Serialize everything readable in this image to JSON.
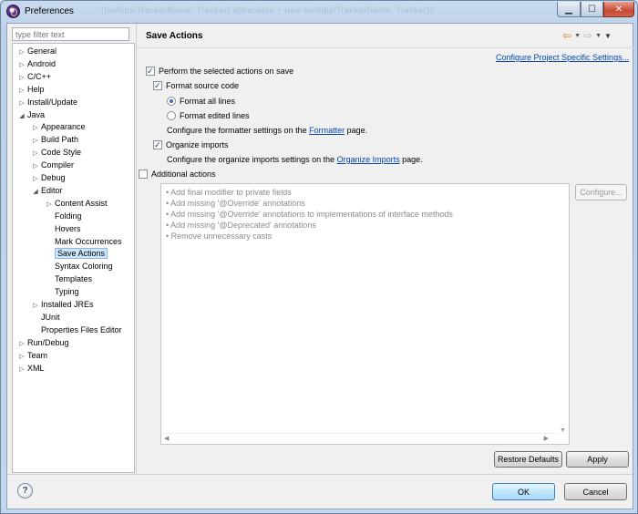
{
  "window": {
    "title": "Preferences",
    "blurred_title_text": "(tooltips/TrackerName, Tracker) a(trackers + new tooltips/TrackerName, Tracker));"
  },
  "filter": {
    "placeholder": "type filter text"
  },
  "tree": [
    {
      "label": "General",
      "arrow": "▷",
      "indent": 0
    },
    {
      "label": "Android",
      "arrow": "▷",
      "indent": 0
    },
    {
      "label": "C/C++",
      "arrow": "▷",
      "indent": 0
    },
    {
      "label": "Help",
      "arrow": "▷",
      "indent": 0
    },
    {
      "label": "Install/Update",
      "arrow": "▷",
      "indent": 0
    },
    {
      "label": "Java",
      "arrow": "◢",
      "indent": 0
    },
    {
      "label": "Appearance",
      "arrow": "▷",
      "indent": 1
    },
    {
      "label": "Build Path",
      "arrow": "▷",
      "indent": 1
    },
    {
      "label": "Code Style",
      "arrow": "▷",
      "indent": 1
    },
    {
      "label": "Compiler",
      "arrow": "▷",
      "indent": 1
    },
    {
      "label": "Debug",
      "arrow": "▷",
      "indent": 1
    },
    {
      "label": "Editor",
      "arrow": "◢",
      "indent": 1
    },
    {
      "label": "Content Assist",
      "arrow": "▷",
      "indent": 2
    },
    {
      "label": "Folding",
      "arrow": "",
      "indent": 2
    },
    {
      "label": "Hovers",
      "arrow": "",
      "indent": 2
    },
    {
      "label": "Mark Occurrences",
      "arrow": "",
      "indent": 2
    },
    {
      "label": "Save Actions",
      "arrow": "",
      "indent": 2,
      "selected": true
    },
    {
      "label": "Syntax Coloring",
      "arrow": "",
      "indent": 2
    },
    {
      "label": "Templates",
      "arrow": "",
      "indent": 2
    },
    {
      "label": "Typing",
      "arrow": "",
      "indent": 2
    },
    {
      "label": "Installed JREs",
      "arrow": "▷",
      "indent": 1
    },
    {
      "label": "JUnit",
      "arrow": "",
      "indent": 1
    },
    {
      "label": "Properties Files Editor",
      "arrow": "",
      "indent": 1
    },
    {
      "label": "Run/Debug",
      "arrow": "▷",
      "indent": 0
    },
    {
      "label": "Team",
      "arrow": "▷",
      "indent": 0
    },
    {
      "label": "XML",
      "arrow": "▷",
      "indent": 0
    }
  ],
  "page": {
    "title": "Save Actions",
    "configure_project_link": "Configure Project Specific Settings...",
    "perform_on_save": {
      "label": "Perform the selected actions on save",
      "checked": true
    },
    "format_source": {
      "label": "Format source code",
      "checked": true
    },
    "format_all": {
      "label": "Format all lines",
      "selected": true
    },
    "format_edited": {
      "label": "Format edited lines",
      "selected": false
    },
    "formatter_note": {
      "before": "Configure the formatter settings on the ",
      "link": "Formatter",
      "after": " page."
    },
    "organize_imports": {
      "label": "Organize imports",
      "checked": true
    },
    "imports_note": {
      "before": "Configure the organize imports settings on the ",
      "link": "Organize Imports",
      "after": " page."
    },
    "additional_actions": {
      "label": "Additional actions",
      "checked": false
    },
    "action_items": [
      "Add final modifier to private fields",
      "Add missing '@Override' annotations",
      "Add missing '@Override' annotations to implementations of interface methods",
      "Add missing '@Deprecated' annotations",
      "Remove unnecessary casts"
    ],
    "configure_button": "Configure...",
    "restore_defaults": "Restore Defaults",
    "apply": "Apply"
  },
  "dialog": {
    "help_icon": "?",
    "ok": "OK",
    "cancel": "Cancel"
  },
  "colors": {
    "link": "#0645ad",
    "selection": "#cde6fb",
    "disabled_text": "#8b8b8b"
  }
}
